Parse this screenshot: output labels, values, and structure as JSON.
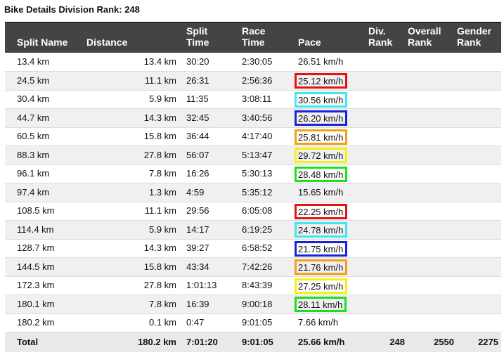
{
  "page_title": "Bike Details Division Rank: 248",
  "headers": {
    "split_name": "Split Name",
    "distance": "Distance",
    "split_time_1": "Split",
    "split_time_2": "Time",
    "race_time_1": "Race",
    "race_time_2": "Time",
    "pace": "Pace",
    "div_rank_1": "Div.",
    "div_rank_2": "Rank",
    "overall_rank_1": "Overall",
    "overall_rank_2": "Rank",
    "gender_rank_1": "Gender",
    "gender_rank_2": "Rank"
  },
  "rows": [
    {
      "name": "13.4 km",
      "distance": "13.4 km",
      "split": "30:20",
      "race": "2:30:05",
      "pace": "26.51 km/h",
      "highlight": ""
    },
    {
      "name": "24.5 km",
      "distance": "11.1 km",
      "split": "26:31",
      "race": "2:56:36",
      "pace": "25.12 km/h",
      "highlight": "#e81010"
    },
    {
      "name": "30.4 km",
      "distance": "5.9 km",
      "split": "11:35",
      "race": "3:08:11",
      "pace": "30.56 km/h",
      "highlight": "#3ee8f0"
    },
    {
      "name": "44.7 km",
      "distance": "14.3 km",
      "split": "32:45",
      "race": "3:40:56",
      "pace": "26.20 km/h",
      "highlight": "#1b22d8"
    },
    {
      "name": "60.5 km",
      "distance": "15.8 km",
      "split": "36:44",
      "race": "4:17:40",
      "pace": "25.81 km/h",
      "highlight": "#f5a014"
    },
    {
      "name": "88.3 km",
      "distance": "27.8 km",
      "split": "56:07",
      "race": "5:13:47",
      "pace": "29.72 km/h",
      "highlight": "#f5f016"
    },
    {
      "name": "96.1 km",
      "distance": "7.8 km",
      "split": "16:26",
      "race": "5:30:13",
      "pace": "28.48 km/h",
      "highlight": "#1de01d"
    },
    {
      "name": "97.4 km",
      "distance": "1.3 km",
      "split": "4:59",
      "race": "5:35:12",
      "pace": "15.65 km/h",
      "highlight": ""
    },
    {
      "name": "108.5 km",
      "distance": "11.1 km",
      "split": "29:56",
      "race": "6:05:08",
      "pace": "22.25 km/h",
      "highlight": "#e81010"
    },
    {
      "name": "114.4 km",
      "distance": "5.9 km",
      "split": "14:17",
      "race": "6:19:25",
      "pace": "24.78 km/h",
      "highlight": "#3ee8f0"
    },
    {
      "name": "128.7 km",
      "distance": "14.3 km",
      "split": "39:27",
      "race": "6:58:52",
      "pace": "21.75 km/h",
      "highlight": "#1b22d8"
    },
    {
      "name": "144.5 km",
      "distance": "15.8 km",
      "split": "43:34",
      "race": "7:42:26",
      "pace": "21.76 km/h",
      "highlight": "#f5a014"
    },
    {
      "name": "172.3 km",
      "distance": "27.8 km",
      "split": "1:01:13",
      "race": "8:43:39",
      "pace": "27.25 km/h",
      "highlight": "#f5f016"
    },
    {
      "name": "180.1 km",
      "distance": "7.8 km",
      "split": "16:39",
      "race": "9:00:18",
      "pace": "28.11 km/h",
      "highlight": "#1de01d"
    },
    {
      "name": "180.2 km",
      "distance": "0.1 km",
      "split": "0:47",
      "race": "9:01:05",
      "pace": "7.66 km/h",
      "highlight": ""
    }
  ],
  "total": {
    "name": "Total",
    "distance": "180.2 km",
    "split": "7:01:20",
    "race": "9:01:05",
    "pace": "25.66 km/h",
    "div_rank": "248",
    "overall_rank": "2550",
    "gender_rank": "2275"
  }
}
